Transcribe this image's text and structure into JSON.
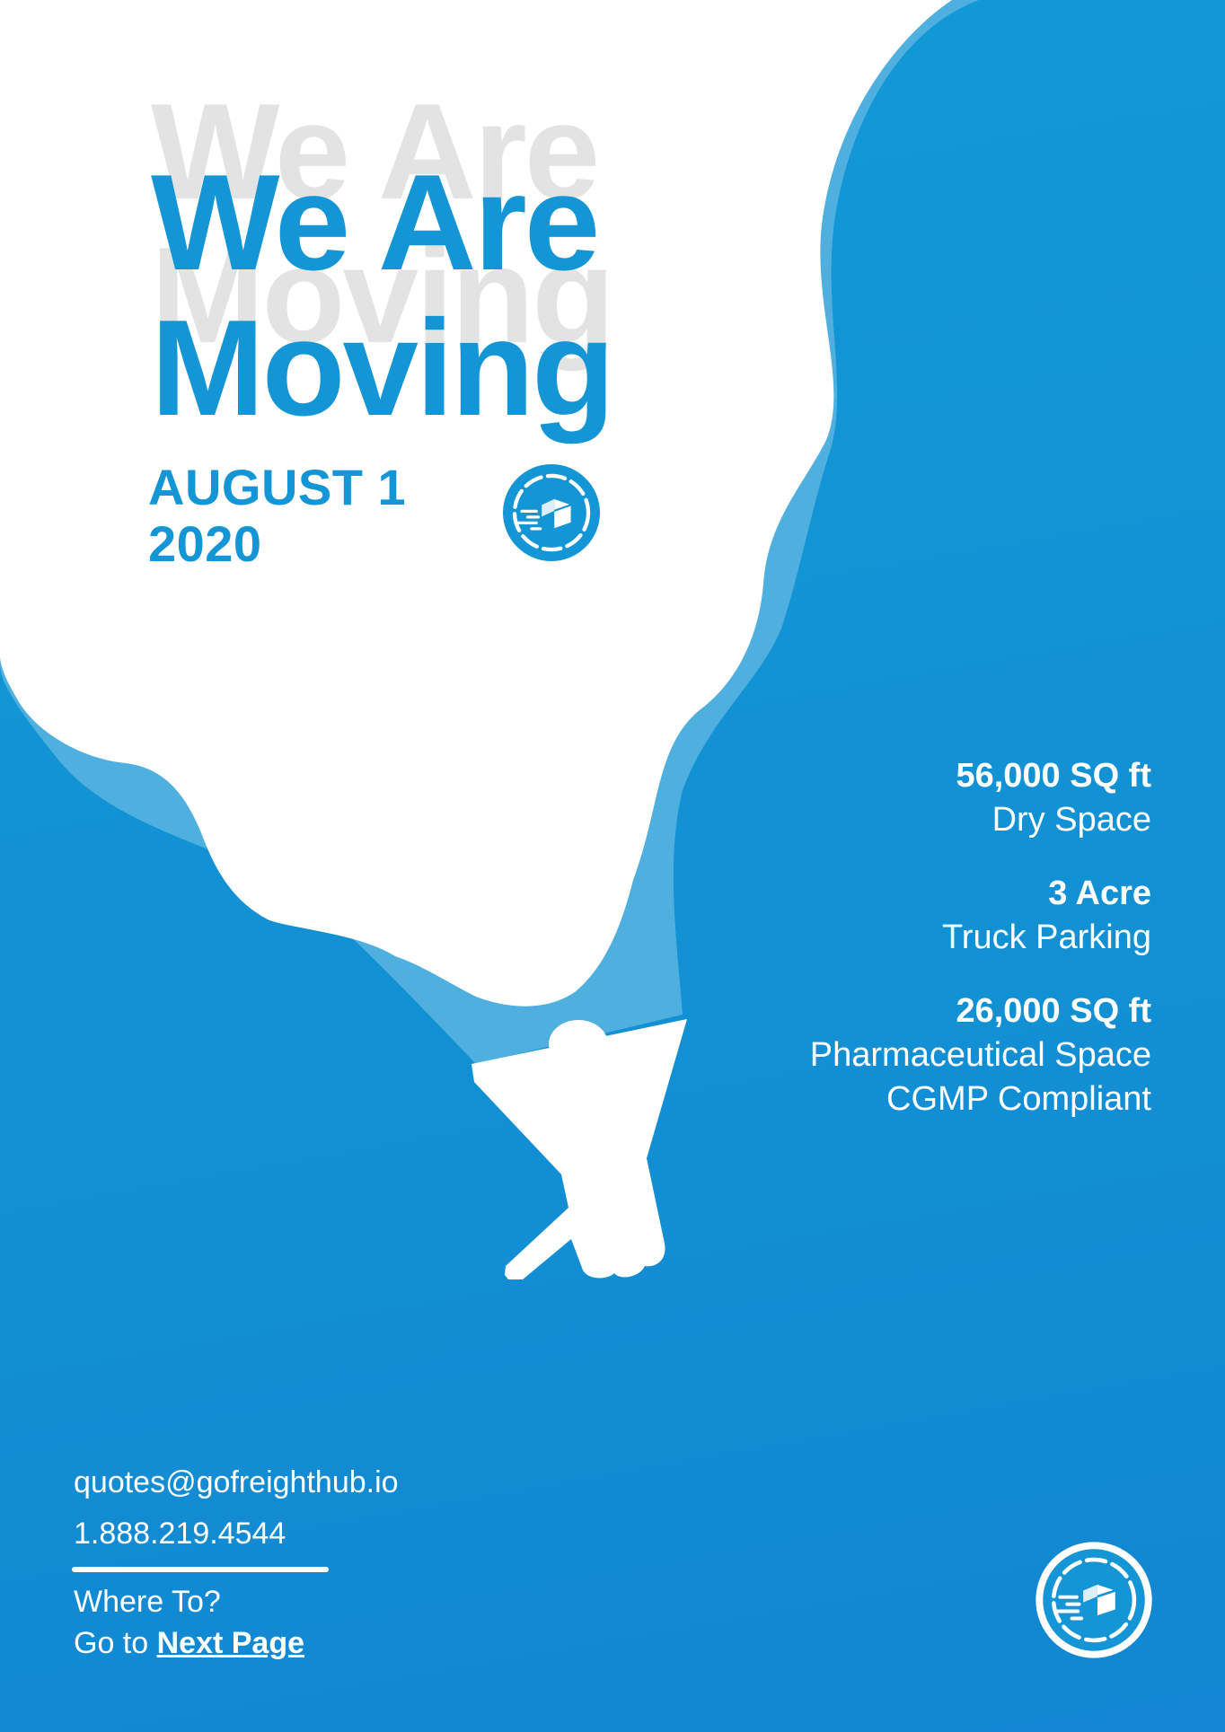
{
  "headline": {
    "line1": "We Are",
    "line2": "Moving"
  },
  "date": {
    "line1": "AUGUST 1",
    "line2": "2020"
  },
  "specs": [
    {
      "title": "56,000 SQ ft",
      "lines": [
        "Dry Space"
      ]
    },
    {
      "title": "3 Acre",
      "lines": [
        "Truck Parking"
      ]
    },
    {
      "title": "26,000 SQ ft",
      "lines": [
        "Pharmaceutical Space",
        "CGMP Compliant"
      ]
    }
  ],
  "contact": {
    "email": "quotes@gofreighthub.io",
    "phone": "1.888.219.4544"
  },
  "navigation": {
    "question": "Where To?",
    "prefix": "Go to ",
    "link_label": "Next Page"
  },
  "icons": {
    "brand_logo": "moving-box-logo-icon",
    "hand": "hand-holding-speech-bubble-icon"
  },
  "colors": {
    "primary_blue": "#1495d5",
    "light_blue": "#4fb0e0",
    "shadow_text": "#e3e3e3",
    "white": "#ffffff"
  }
}
